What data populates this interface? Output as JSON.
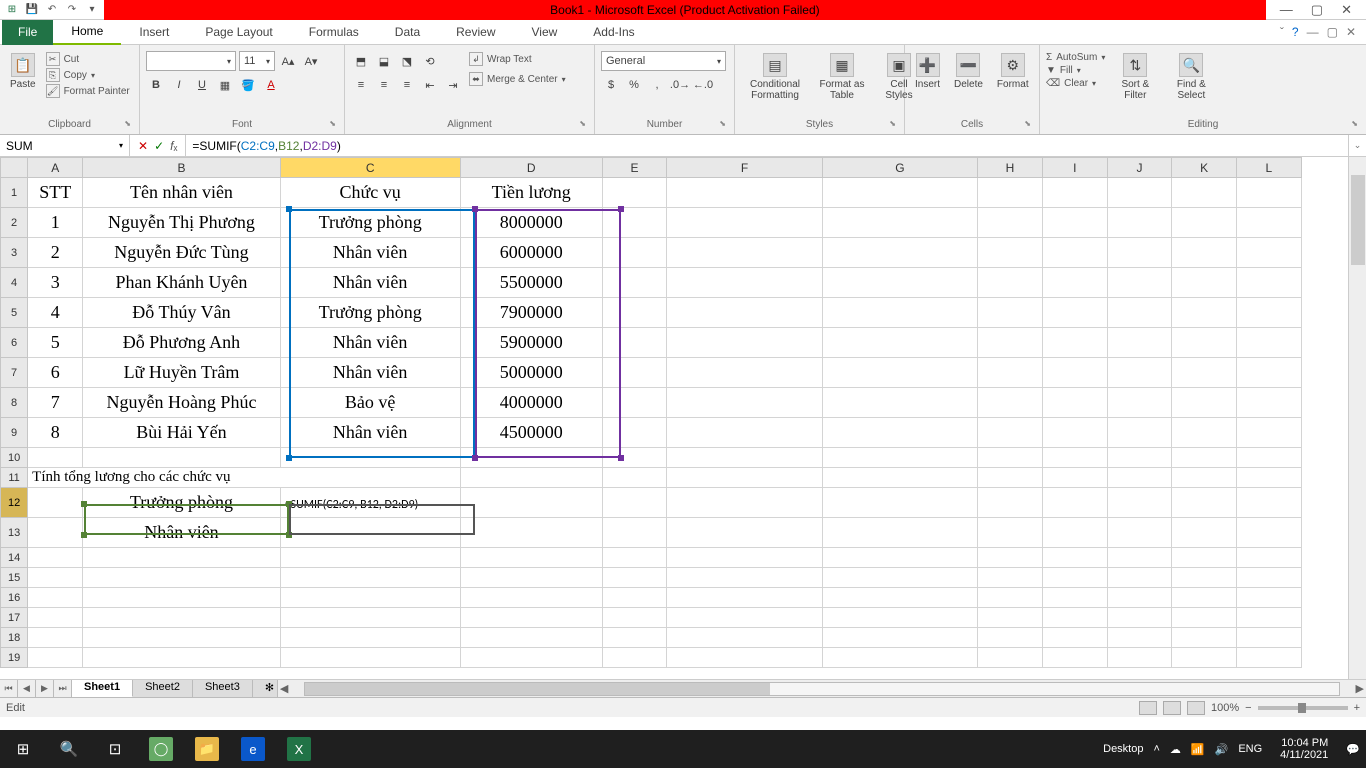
{
  "title": "Book1 - Microsoft Excel (Product Activation Failed)",
  "tabs": {
    "file": "File",
    "home": "Home",
    "insert": "Insert",
    "pageLayout": "Page Layout",
    "formulas": "Formulas",
    "data": "Data",
    "review": "Review",
    "view": "View",
    "addins": "Add-Ins"
  },
  "ribbon": {
    "clipboard": {
      "paste": "Paste",
      "cut": "Cut",
      "copy": "Copy",
      "formatPainter": "Format Painter",
      "label": "Clipboard"
    },
    "font": {
      "fontName": "",
      "fontSize": "11",
      "label": "Font"
    },
    "alignment": {
      "wrap": "Wrap Text",
      "merge": "Merge & Center",
      "label": "Alignment"
    },
    "number": {
      "format": "General",
      "label": "Number"
    },
    "styles": {
      "conditional": "Conditional Formatting",
      "formatTable": "Format as Table",
      "cellStyles": "Cell Styles",
      "label": "Styles"
    },
    "cells": {
      "insert": "Insert",
      "delete": "Delete",
      "format": "Format",
      "label": "Cells"
    },
    "editing": {
      "autosum": "AutoSum",
      "fill": "Fill",
      "clear": "Clear",
      "sortFilter": "Sort & Filter",
      "findSelect": "Find & Select",
      "label": "Editing"
    }
  },
  "nameBox": "SUM",
  "formula": {
    "prefix": "=SUMIF(",
    "r1": "C2:C9",
    "sep1": ", ",
    "r2": "B12",
    "sep2": ", ",
    "r3": "D2:D9",
    "suffix": ")"
  },
  "columns": [
    "A",
    "B",
    "C",
    "D",
    "E",
    "F",
    "G",
    "H",
    "I",
    "J",
    "K",
    "L"
  ],
  "activeCol": "C",
  "activeRow": 12,
  "headers": {
    "A": "STT",
    "B": "Tên nhân viên",
    "C": "Chức vụ",
    "D": "Tiền lương"
  },
  "rows": [
    {
      "stt": "1",
      "name": "Nguyễn Thị Phương",
      "role": "Trưởng phòng",
      "salary": "8000000"
    },
    {
      "stt": "2",
      "name": "Nguyễn Đức Tùng",
      "role": "Nhân viên",
      "salary": "6000000"
    },
    {
      "stt": "3",
      "name": "Phan Khánh Uyên",
      "role": "Nhân viên",
      "salary": "5500000"
    },
    {
      "stt": "4",
      "name": "Đỗ Thúy Vân",
      "role": "Trưởng phòng",
      "salary": "7900000"
    },
    {
      "stt": "5",
      "name": "Đỗ Phương Anh",
      "role": "Nhân viên",
      "salary": "5900000"
    },
    {
      "stt": "6",
      "name": "Lữ Huyền Trâm",
      "role": "Nhân viên",
      "salary": "5000000"
    },
    {
      "stt": "7",
      "name": "Nguyễn Hoàng Phúc",
      "role": "Bảo  vệ",
      "salary": "4000000"
    },
    {
      "stt": "8",
      "name": "Bùi Hải Yến",
      "role": "Nhân viên",
      "salary": "4500000"
    }
  ],
  "row11": "Tính tổng lương cho các chức vụ",
  "b12": "Trưởng phòng",
  "b13": "Nhân viên",
  "c12": "=SUMIF(C2:C9, B12, D2:D9)",
  "sheetTabs": [
    "Sheet1",
    "Sheet2",
    "Sheet3"
  ],
  "status": {
    "mode": "Edit",
    "zoom": "100%"
  },
  "taskbar": {
    "desktop": "Desktop",
    "lang": "ENG",
    "time": "10:04 PM",
    "date": "4/11/2021"
  }
}
